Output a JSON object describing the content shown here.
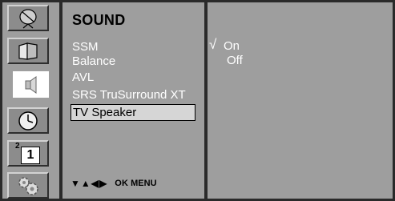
{
  "menu": {
    "title": "SOUND",
    "items": [
      {
        "label": "SSM",
        "active": false
      },
      {
        "label": "Balance",
        "active": false
      },
      {
        "label": "AVL",
        "active": false
      },
      {
        "label": "SRS TruSurround XT",
        "active": false
      },
      {
        "label": "TV Speaker",
        "active": true
      }
    ]
  },
  "icons": [
    {
      "name": "satellite-dish-icon",
      "state": "raised"
    },
    {
      "name": "picture-icon",
      "state": "raised"
    },
    {
      "name": "speaker-icon",
      "state": "selected"
    },
    {
      "name": "clock-icon",
      "state": "raised"
    },
    {
      "name": "channel-number-icon",
      "state": "raised",
      "text_small": "2",
      "text_big": "1"
    },
    {
      "name": "gear-icon",
      "state": "raised"
    }
  ],
  "options": {
    "checkmark": "√",
    "items": [
      {
        "label": "On",
        "selected": true
      },
      {
        "label": "Off",
        "selected": false
      }
    ]
  },
  "nav": {
    "arrows": "▼▲◀▶",
    "ok": "OK",
    "menu": "MENU"
  },
  "colors": {
    "panel": "#9e9e9e",
    "border": "#2a2a2a",
    "text": "#ffffff",
    "highlight": "#d6d6d6"
  }
}
